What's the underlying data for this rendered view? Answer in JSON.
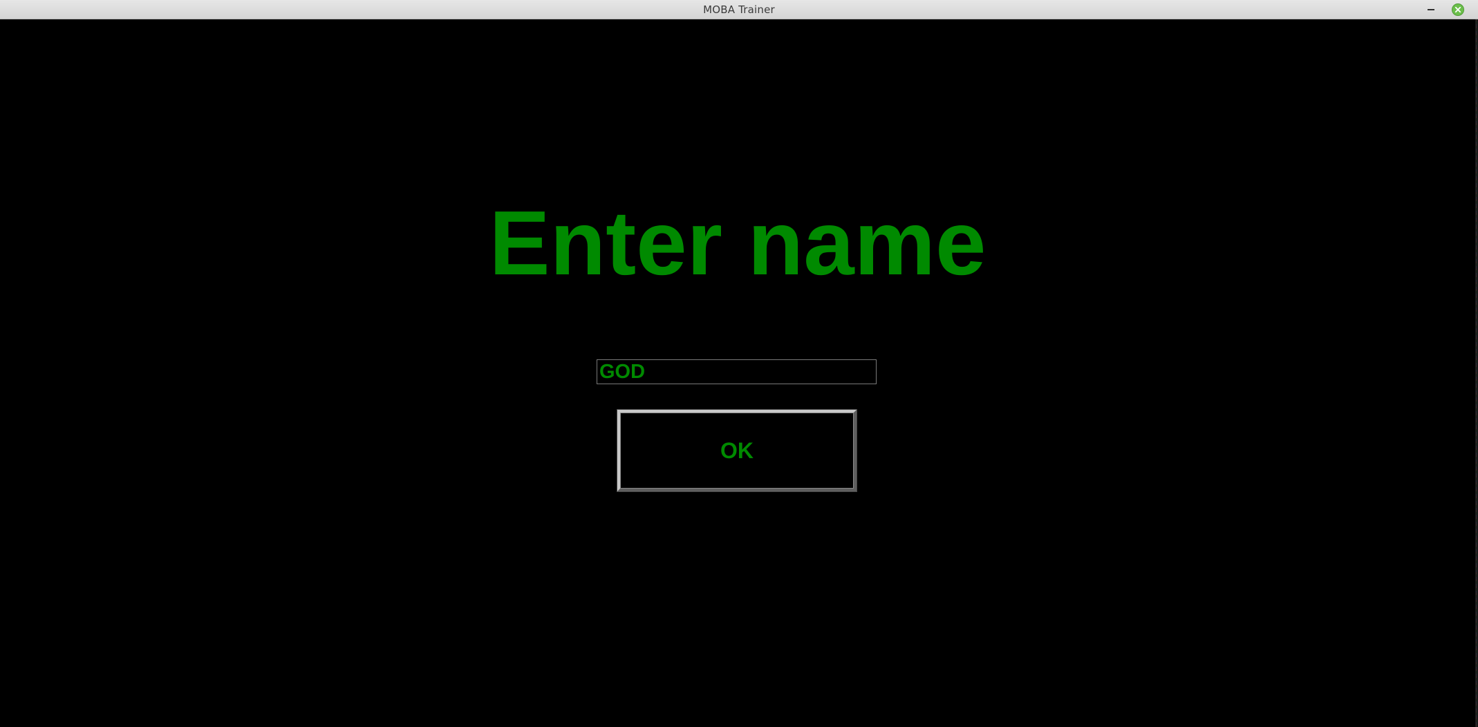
{
  "window": {
    "title": "MOBA Trainer",
    "controls": {
      "minimize_icon": "minimize-icon",
      "close_icon": "close-icon"
    }
  },
  "screen": {
    "heading": "Enter name",
    "name_input": {
      "value": "GOD",
      "placeholder": ""
    },
    "ok_button": {
      "label": "OK"
    }
  },
  "colors": {
    "background": "#000000",
    "text_green": "#008a00",
    "titlebar": "#dcdcdc",
    "close_button": "#6cbf4c"
  }
}
